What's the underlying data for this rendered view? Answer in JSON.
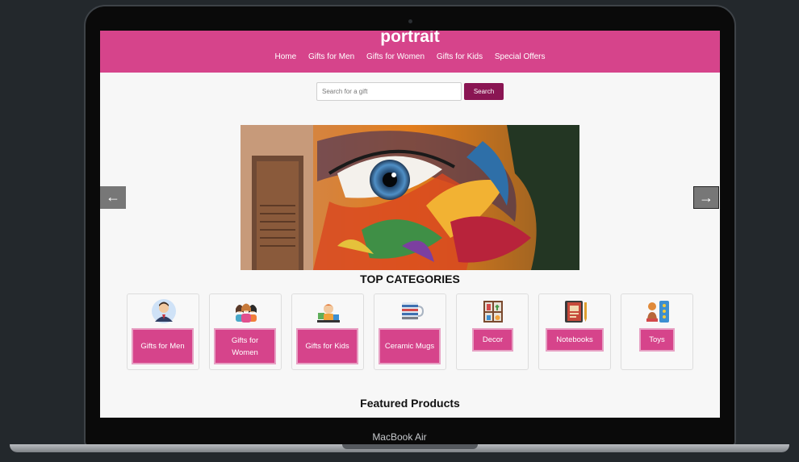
{
  "device": {
    "label": "MacBook Air"
  },
  "site": {
    "title": "portrait"
  },
  "nav": [
    "Home",
    "Gifts for Men",
    "Gifts for Women",
    "Gifts for Kids",
    "Special Offers"
  ],
  "search": {
    "placeholder": "Search for a gift",
    "button_label": "Search"
  },
  "carousel": {
    "prev_label": "←",
    "next_label": "→"
  },
  "categories": {
    "title": "TOP CATEGORIES",
    "items": [
      {
        "label": "Gifts for Men",
        "icon": "man-icon"
      },
      {
        "label": "Gifts for Women",
        "icon": "women-group-icon"
      },
      {
        "label": "Gifts for Kids",
        "icon": "kid-icon"
      },
      {
        "label": "Ceramic Mugs",
        "icon": "mugs-icon"
      },
      {
        "label": "Decor",
        "icon": "decor-shelf-icon"
      },
      {
        "label": "Notebooks",
        "icon": "notebook-icon"
      },
      {
        "label": "Toys",
        "icon": "toys-icon"
      }
    ]
  },
  "featured": {
    "title": "Featured Products"
  },
  "colors": {
    "brand": "#d6448b",
    "search_button": "#8a1553",
    "background": "#f7f7f7"
  }
}
